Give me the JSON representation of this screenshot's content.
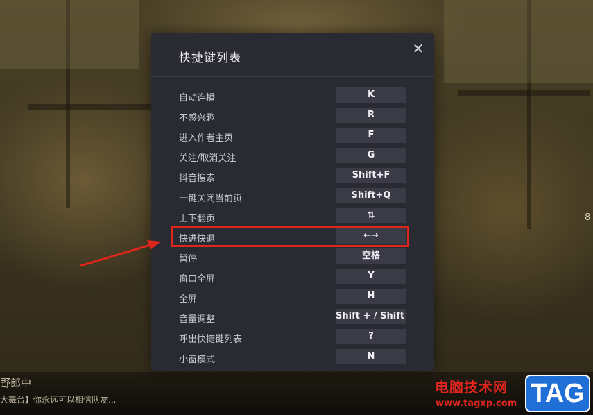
{
  "modal": {
    "title": "快捷键列表",
    "close_symbol": "✕",
    "shortcuts": [
      {
        "label": "自动连播",
        "key": "K"
      },
      {
        "label": "不感兴趣",
        "key": "R"
      },
      {
        "label": "进入作者主页",
        "key": "F"
      },
      {
        "label": "关注/取消关注",
        "key": "G"
      },
      {
        "label": "抖音搜索",
        "key": "Shift+F"
      },
      {
        "label": "一键关闭当前页",
        "key": "Shift+Q"
      },
      {
        "label": "上下翻页",
        "key": "⇅"
      },
      {
        "label": "快进快退",
        "key": "←→"
      },
      {
        "label": "暂停",
        "key": "空格"
      },
      {
        "label": "窗口全屏",
        "key": "Y"
      },
      {
        "label": "全屏",
        "key": "H"
      },
      {
        "label": "音量调整",
        "key": "Shift + / Shift -"
      },
      {
        "label": "呼出快捷键列表",
        "key": "?"
      },
      {
        "label": "小窗模式",
        "key": "N"
      }
    ]
  },
  "video": {
    "title": "野郎中",
    "description": "大舞台】你永远可以相信队友...",
    "right_count": "8"
  },
  "watermark": {
    "text": "电脑技术网",
    "url": "www.tagxp.com",
    "tag": "TAG"
  },
  "colors": {
    "highlight": "#e0251c",
    "modal_bg": "#2a2a33",
    "key_bg": "#3b3b47",
    "watermark_red": "#e0261f",
    "watermark_blue": "#1f6fd6"
  }
}
